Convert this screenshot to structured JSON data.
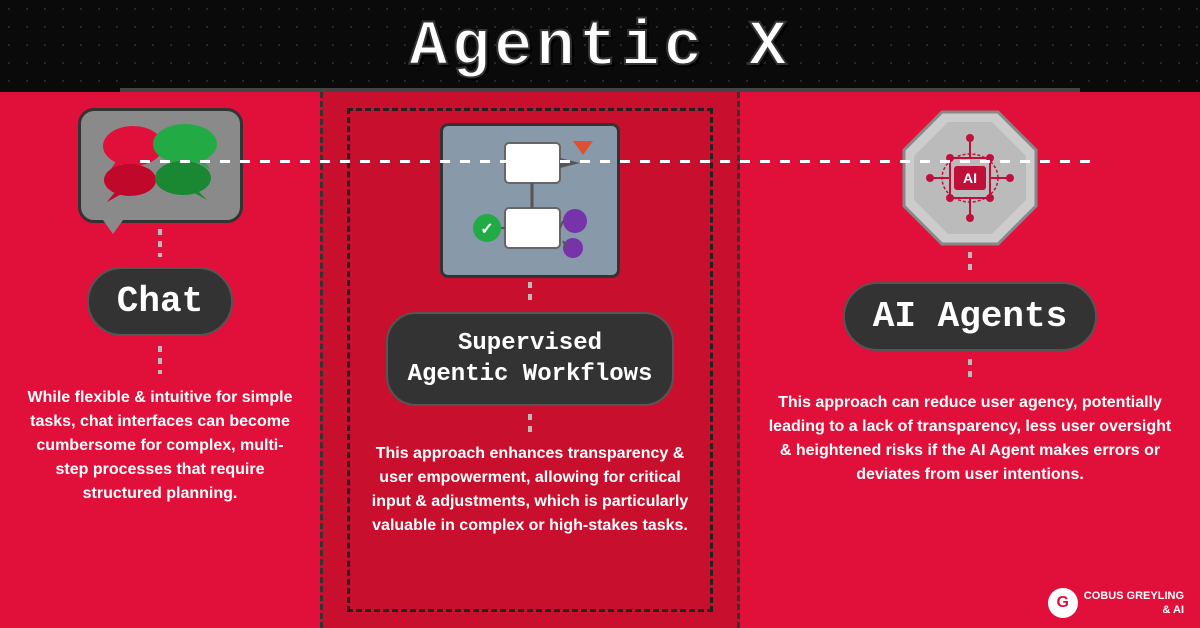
{
  "title": "Agentic X",
  "header_line": true,
  "columns": {
    "left": {
      "icon_alt": "chat-bubbles-icon",
      "label": "Chat",
      "description": "While flexible & intuitive for simple tasks, chat interfaces can become cumbersome for complex, multi-step processes that require structured planning."
    },
    "middle": {
      "icon_alt": "supervised-workflow-icon",
      "label_line1": "Supervised",
      "label_line2": "Agentic  Workflows",
      "description": "This approach enhances transparency & user empowerment, allowing for critical input & adjustments, which is particularly valuable in complex or high-stakes tasks."
    },
    "right": {
      "icon_alt": "ai-agent-icon",
      "label": "AI Agents",
      "description": "This approach can reduce user agency, potentially leading to a lack of transparency, less user oversight & heightened risks if the AI Agent makes errors or deviates from user intentions."
    }
  },
  "branding": {
    "logo_letter": "G",
    "line1": "COBUS GREYLING",
    "line2": "& AI"
  },
  "colors": {
    "background": "#0a0a0a",
    "red": "#e0103a",
    "dark_red": "#c8102e",
    "dark_pill": "#333333",
    "white": "#ffffff",
    "gray_box": "#8899aa",
    "green": "#22aa44",
    "purple": "#7733aa",
    "orange": "#e05030"
  }
}
